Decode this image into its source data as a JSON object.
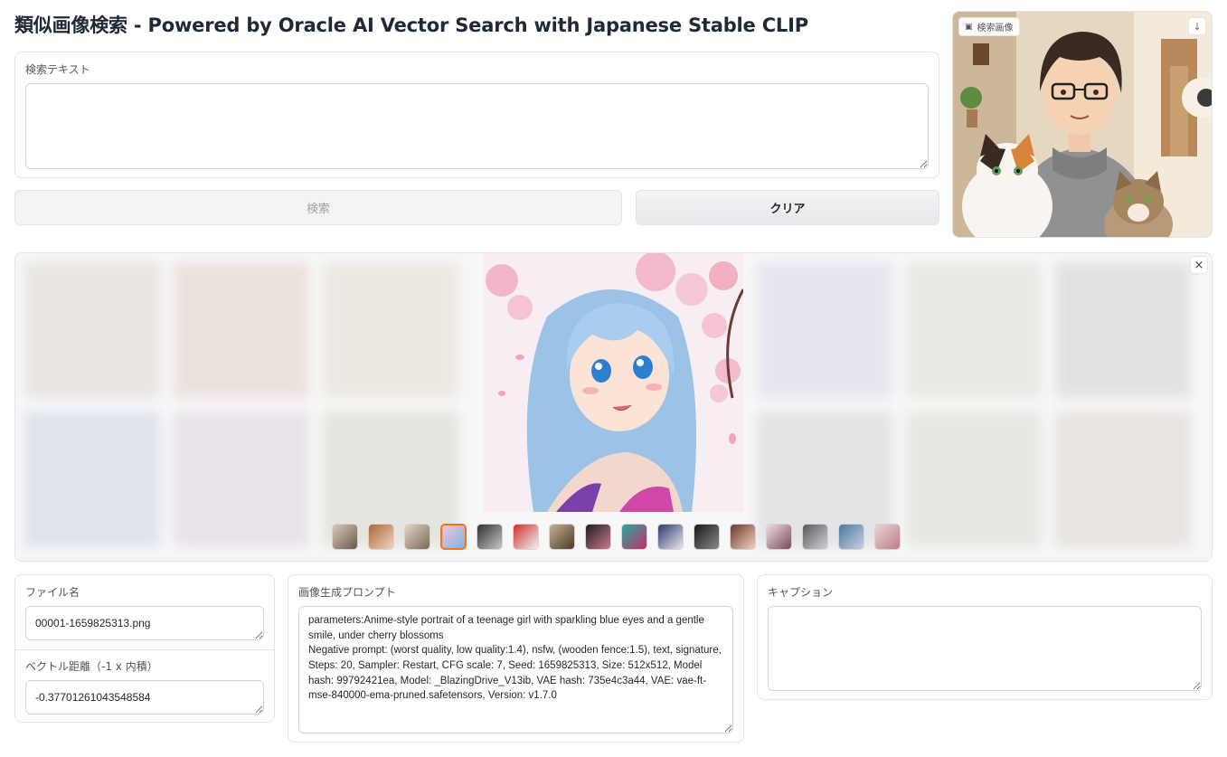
{
  "header": {
    "title": "類似画像検索 - Powered by Oracle AI Vector Search with Japanese Stable CLIP"
  },
  "search": {
    "text_label": "検索テキスト",
    "text_value": "",
    "search_button": "検索",
    "clear_button": "クリア",
    "image_label": "検索画像",
    "download_icon": "↓"
  },
  "gallery": {
    "close_icon": "×",
    "selected_index": 3,
    "thumbnail_count": 16
  },
  "details": {
    "filename_label": "ファイル名",
    "filename_value": "00001-1659825313.png",
    "distance_label": "ベクトル距離（-1 x 内積）",
    "distance_value": "-0.37701261043548584",
    "prompt_label": "画像生成プロンプト",
    "prompt_value": "parameters:Anime-style portrait of a teenage girl with sparkling blue eyes and a gentle smile, under cherry blossoms\nNegative prompt: (worst quality, low quality:1.4), nsfw, (wooden fence:1.5), text, signature,\nSteps: 20, Sampler: Restart, CFG scale: 7, Seed: 1659825313, Size: 512x512, Model hash: 99792421ea, Model: _BlazingDrive_V13ib, VAE hash: 735e4c3a44, VAE: vae-ft-mse-840000-ema-pruned.safetensors, Version: v1.7.0",
    "caption_label": "キャプション",
    "caption_value": ""
  },
  "colors": {
    "accent": "#f97316",
    "border": "#e4e4e7"
  }
}
